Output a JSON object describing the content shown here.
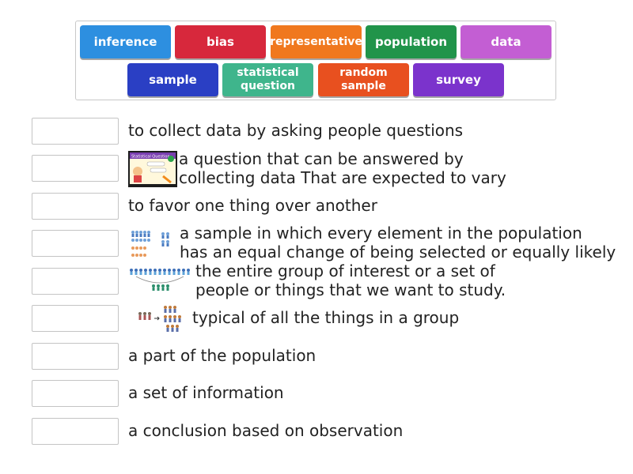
{
  "tiles": [
    {
      "label": "inference",
      "color": "#2d8fe0"
    },
    {
      "label": "bias",
      "color": "#d7283c"
    },
    {
      "label": "representative",
      "color": "#f0781e"
    },
    {
      "label": "population",
      "color": "#21944a"
    },
    {
      "label": "data",
      "color": "#c35ed3"
    },
    {
      "label": "sample",
      "color": "#2a3fc4"
    },
    {
      "label": "statistical\nquestion",
      "color": "#3fb58c"
    },
    {
      "label": "random\nsample",
      "color": "#e8501f"
    },
    {
      "label": "survey",
      "color": "#7b33cc"
    }
  ],
  "descriptions": [
    "to collect data by asking people questions",
    "a question that can be answered by\ncollecting data That are expected to vary",
    "to favor one thing over another",
    "a sample in which every element in the population\nhas an equal change of being selected or equally likely",
    "the entire group of interest or a set of\n people or things that we want to study.",
    "typical of all the things in a group",
    "a part of the population",
    "a set of information",
    "a conclusion based on observation"
  ],
  "thumbnail_text": {
    "statistical_question": "Statistical Question"
  }
}
